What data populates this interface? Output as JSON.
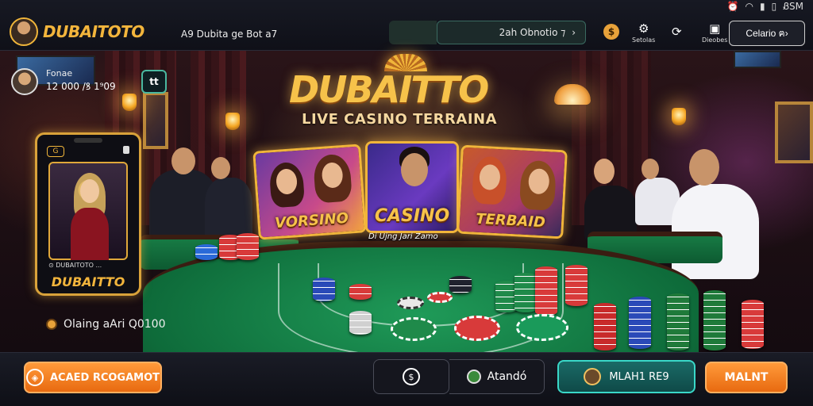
{
  "status": {
    "time": "ᏰЅM"
  },
  "header": {
    "brand": "DUBAITOTO",
    "nav_link": "A9 Dubita ge Bot a7",
    "search": {
      "value": "2ah Obnotio ⁊",
      "chevron": "›"
    },
    "icons": [
      {
        "icon": "gear-icon",
        "label": "Setolas"
      },
      {
        "icon": "refresh-icon",
        "label": ""
      },
      {
        "icon": "wallet-icon",
        "label": "Dieobes"
      }
    ],
    "action_button": "Celario ฅ›"
  },
  "profile": {
    "name": "Fonae",
    "balance": "12 000 /ꝸ 1⁹09",
    "badge": "tt"
  },
  "hero": {
    "title": "DUBAITTO",
    "subtitle": "LIVE CASINO TERRAINA"
  },
  "games": [
    {
      "label": "VORSINO"
    },
    {
      "label": "CASINO"
    },
    {
      "label": "TERBAID"
    }
  ],
  "games_caption": "Di Ujng Jari Zamo",
  "phone_card": {
    "tag": "G",
    "caption": "⊙ DUBAITOTO ...",
    "brand": "DUBAITTO"
  },
  "left_info": "Olaing aAri Q0100",
  "bottom": {
    "left_button": "ACAED RCOGAMOT",
    "center_button": "Atandó",
    "teal_button": "MLAH1 RE9",
    "right_button": "MALNT"
  },
  "colors": {
    "accent_gold": "#f3b53c",
    "accent_orange": "#f07a1a",
    "accent_teal": "#3ad8c8",
    "felt_green": "#0e6b3a"
  }
}
